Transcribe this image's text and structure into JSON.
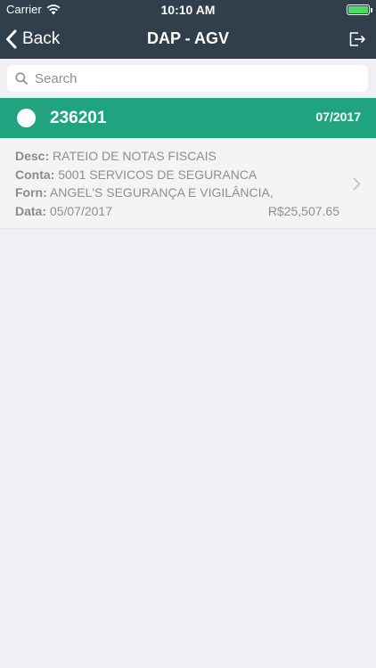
{
  "status_bar": {
    "carrier": "Carrier",
    "time": "10:10 AM",
    "battery_level": 1.0,
    "battery_color": "#4cd964"
  },
  "nav": {
    "back_label": "Back",
    "title": "DAP - AGV",
    "exit_icon": "exit-icon"
  },
  "search": {
    "placeholder": "Search",
    "value": ""
  },
  "group": {
    "number": "236201",
    "period": "07/2017",
    "color": "#1fa47f"
  },
  "record": {
    "desc_label": "Desc:",
    "desc_value": "RATEIO DE NOTAS FISCAIS",
    "conta_label": "Conta:",
    "conta_value": "5001 SERVICOS DE SEGURANCA",
    "forn_label": "Forn:",
    "forn_value": "ANGEL'S SEGURANÇA E VIGILÂNCIA,",
    "data_label": "Data:",
    "data_value": "05/07/2017",
    "amount": "R$25,507.65"
  },
  "colors": {
    "header_bg": "#313e4b",
    "page_bg": "#efeff4"
  }
}
